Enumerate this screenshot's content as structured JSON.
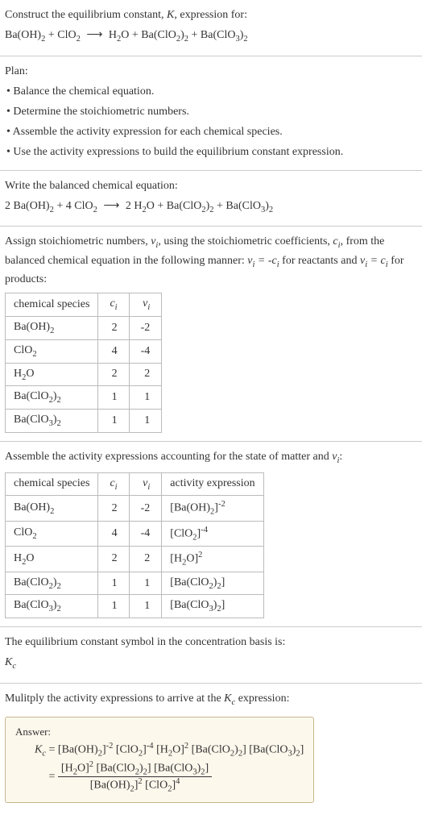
{
  "q_title": "Construct the equilibrium constant, ",
  "k_sym": "K",
  "q_after": ", expression for:",
  "eqn0_left": "Ba(OH)",
  "eqn0_left2": " + ClO",
  "arrow": "⟶",
  "eqn0_r1": "H",
  "eqn0_r2": "O + Ba(ClO",
  "eqn0_r3": ")",
  "eqn0_r4": " + Ba(ClO",
  "eqn0_r5": ")",
  "plan_h": "Plan:",
  "plan1": "• Balance the chemical equation.",
  "plan2": "• Determine the stoichiometric numbers.",
  "plan3": "• Assemble the activity expression for each chemical species.",
  "plan4": "• Use the activity expressions to build the equilibrium constant expression.",
  "balanced_h": "Write the balanced chemical equation:",
  "bal": {
    "a": "2 Ba(OH)",
    "b": " + 4 ClO",
    "c": "2 H",
    "d": "O + Ba(ClO",
    "e": ")",
    "f": " + Ba(ClO",
    "g": ")"
  },
  "stoich_text1": "Assign stoichiometric numbers, ",
  "stoich_text2": ", using the stoichiometric coefficients, ",
  "stoich_text3": ", from the balanced chemical equation in the following manner: ",
  "stoich_text4": " for reactants and ",
  "stoich_text5": " for products:",
  "th_species": "chemical species",
  "th_ci": "c",
  "th_vi": "ν",
  "t1": {
    "r1": {
      "s": "Ba(OH)",
      "s2": "2",
      "c": "2",
      "v": "-2"
    },
    "r2": {
      "s": "ClO",
      "s2": "2",
      "c": "4",
      "v": "-4"
    },
    "r3": {
      "s": "H",
      "s2": "2",
      "s3": "O",
      "c": "2",
      "v": "2"
    },
    "r4": {
      "s": "Ba(ClO",
      "s2": "2",
      "s3": ")",
      "s4": "2",
      "c": "1",
      "v": "1"
    },
    "r5": {
      "s": "Ba(ClO",
      "s2": "3",
      "s3": ")",
      "s4": "2",
      "c": "1",
      "v": "1"
    }
  },
  "activity_h": "Assemble the activity expressions accounting for the state of matter and ",
  "th_ae": "activity expression",
  "eq_symbol_text": "The equilibrium constant symbol in the concentration basis is:",
  "Kc": "K",
  "mult_text": "Mulitply the activity expressions to arrive at the ",
  "mult_text2": " expression:",
  "answer_label": "Answer:",
  "two": "2",
  "three": "3",
  "four": "4",
  "minus2": "-2",
  "minus4": "-4",
  "eq": " = ",
  "plus": " + ",
  "ob": "[",
  "cb": "]",
  "rel_eq1": "ν",
  "rel_eq2": " = -c",
  "rel_eq3": "ν",
  "rel_eq4": " = c",
  "i": "i",
  "c": "c",
  "chart_data": {
    "type": "table",
    "tables": [
      {
        "columns": [
          "chemical species",
          "c_i",
          "ν_i"
        ],
        "rows": [
          [
            "Ba(OH)2",
            "2",
            "-2"
          ],
          [
            "ClO2",
            "4",
            "-4"
          ],
          [
            "H2O",
            "2",
            "2"
          ],
          [
            "Ba(ClO2)2",
            "1",
            "1"
          ],
          [
            "Ba(ClO3)2",
            "1",
            "1"
          ]
        ]
      },
      {
        "columns": [
          "chemical species",
          "c_i",
          "ν_i",
          "activity expression"
        ],
        "rows": [
          [
            "Ba(OH)2",
            "2",
            "-2",
            "[Ba(OH)2]^-2"
          ],
          [
            "ClO2",
            "4",
            "-4",
            "[ClO2]^-4"
          ],
          [
            "H2O",
            "2",
            "2",
            "[H2O]^2"
          ],
          [
            "Ba(ClO2)2",
            "1",
            "1",
            "[Ba(ClO2)2]"
          ],
          [
            "Ba(ClO3)2",
            "1",
            "1",
            "[Ba(ClO3)2]"
          ]
        ]
      }
    ]
  }
}
